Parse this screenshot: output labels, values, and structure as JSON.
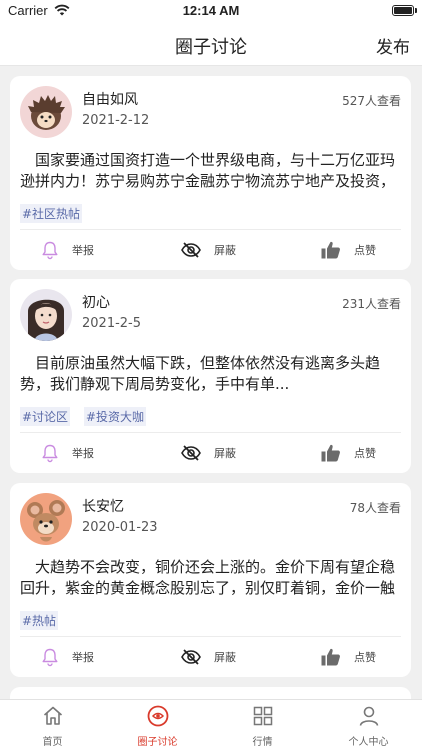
{
  "status_bar": {
    "carrier": "Carrier",
    "time": "12:14 AM"
  },
  "nav": {
    "title": "圈子讨论",
    "publish": "发布"
  },
  "posts": [
    {
      "username": "自由如风",
      "date": "2021-2-12",
      "views": "527人查看",
      "content": "国家要通过国资打造一个世界级电商，与十二万亿亚玛逊拼内力！苏宁易购苏宁金融苏宁物流苏宁地产及投资，比...",
      "tags": [
        "#社区热帖"
      ]
    },
    {
      "username": "初心",
      "date": "2021-2-5",
      "views": "231人查看",
      "content": "目前原油虽然大幅下跌，但整体依然没有逃离多头趋势，我们静观下周局势变化，手中有单...",
      "tags": [
        "#讨论区",
        "#投资大咖"
      ]
    },
    {
      "username": "长安忆",
      "date": "2020-01-23",
      "views": "78人查看",
      "content": "大趋势不会改变，铜价还会上涨的。金价下周有望企稳回升，紫金的黄金概念股别忘了，别仅盯着铜，金价一触即...",
      "tags": [
        "#热帖"
      ]
    }
  ],
  "actions": {
    "report": "举报",
    "hide": "屏蔽",
    "like": "点赞"
  },
  "tabbar": [
    {
      "label": "首页",
      "icon": "home-icon"
    },
    {
      "label": "圈子讨论",
      "icon": "circle-target-icon"
    },
    {
      "label": "行情",
      "icon": "grid-icon"
    },
    {
      "label": "个人中心",
      "icon": "person-icon"
    }
  ],
  "colors": {
    "accent": "#d93a2b",
    "tag_text": "#5a6aa8",
    "tag_bg": "#eef0f8",
    "bell": "#c98be0"
  }
}
